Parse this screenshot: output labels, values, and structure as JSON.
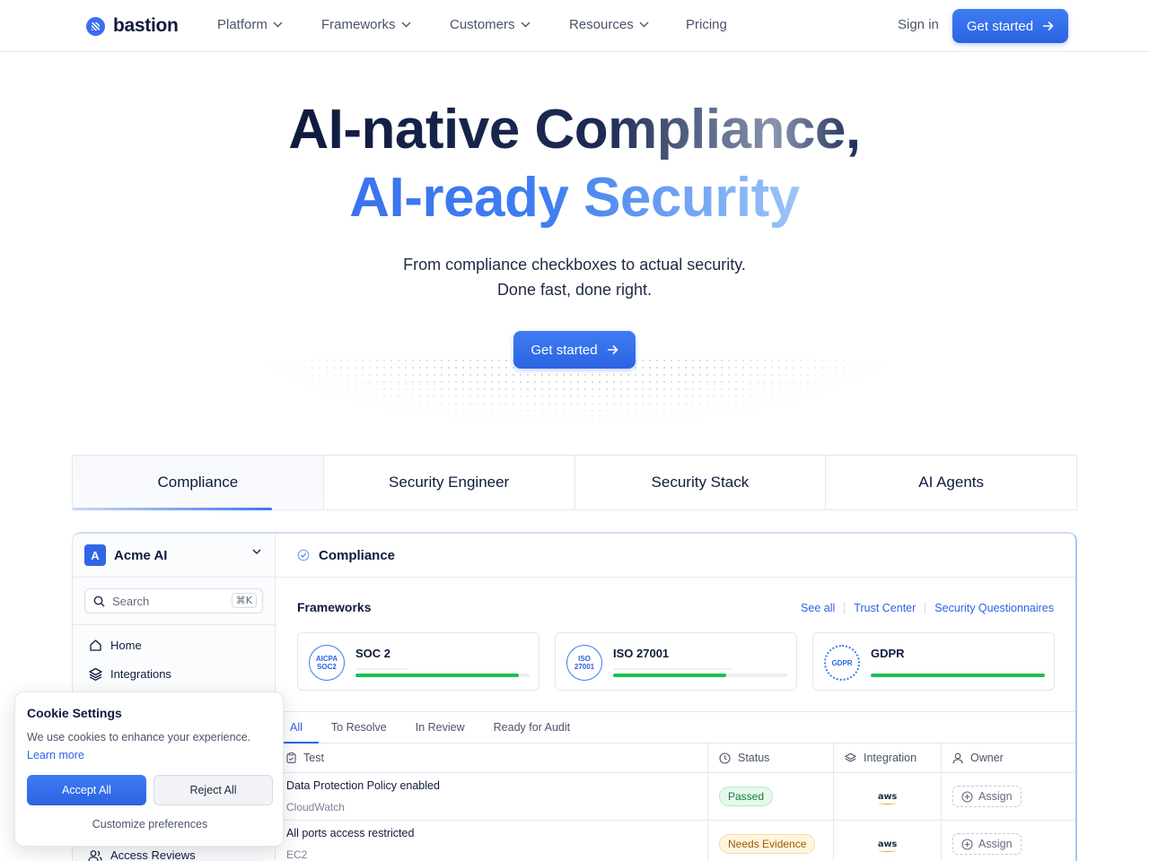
{
  "nav": {
    "brand": "bastion",
    "links": [
      {
        "label": "Platform",
        "has_menu": true
      },
      {
        "label": "Frameworks",
        "has_menu": true
      },
      {
        "label": "Customers",
        "has_menu": true
      },
      {
        "label": "Resources",
        "has_menu": true
      },
      {
        "label": "Pricing",
        "has_menu": false
      }
    ],
    "sign_in": "Sign in",
    "cta": "Get started"
  },
  "hero": {
    "line1": "AI-native Compliance,",
    "line2": "AI-ready Security",
    "subtitle_1": "From compliance checkboxes to actual security.",
    "subtitle_2": "Done fast, done right.",
    "cta": "Get started"
  },
  "tabs": [
    {
      "label": "Compliance",
      "active": true
    },
    {
      "label": "Security Engineer",
      "active": false
    },
    {
      "label": "Security Stack",
      "active": false
    },
    {
      "label": "AI Agents",
      "active": false
    }
  ],
  "app": {
    "org_initial": "A",
    "org_name": "Acme AI",
    "search_placeholder": "Search",
    "search_shortcut": "⌘K",
    "sidebar_items": [
      {
        "label": "Home",
        "icon": "home-icon"
      },
      {
        "label": "Integrations",
        "icon": "layers-icon"
      }
    ],
    "sidebar_peek": {
      "label": "Access Reviews",
      "icon": "users-icon"
    },
    "page_title": "Compliance",
    "frameworks_title": "Frameworks",
    "framework_links": [
      "See all",
      "Trust Center",
      "Security Questionnaires"
    ],
    "frameworks": [
      {
        "name": "SOC 2",
        "seal": "AICPA SOC2",
        "progress": 0.94
      },
      {
        "name": "ISO 27001",
        "seal": "ISO 27001",
        "progress": 0.65
      },
      {
        "name": "GDPR",
        "seal": "GDPR",
        "progress": 1.0
      }
    ],
    "sub_tabs": [
      {
        "label": "All",
        "active": true
      },
      {
        "label": "To Resolve",
        "active": false
      },
      {
        "label": "In Review",
        "active": false
      },
      {
        "label": "Ready for Audit",
        "active": false
      }
    ],
    "columns": {
      "test": "Test",
      "status": "Status",
      "integration": "Integration",
      "owner": "Owner"
    },
    "rows": [
      {
        "name": "Data Protection Policy enabled",
        "source": "CloudWatch",
        "status": "Passed",
        "status_kind": "passed",
        "integration": "aws",
        "owner_action": "Assign"
      },
      {
        "name": "All ports access restricted",
        "source": "EC2",
        "status": "Needs Evidence",
        "status_kind": "evidence",
        "integration": "aws",
        "owner_action": "Assign"
      }
    ]
  },
  "cookie": {
    "title": "Cookie Settings",
    "text": "We use cookies to enhance your experience.",
    "learn_more": "Learn more",
    "accept": "Accept All",
    "reject": "Reject All",
    "customize": "Customize preferences"
  },
  "colors": {
    "accent": "#2c63e2",
    "success": "#19c253",
    "warning": "#f5dda3",
    "ink": "#0f1b3d"
  }
}
